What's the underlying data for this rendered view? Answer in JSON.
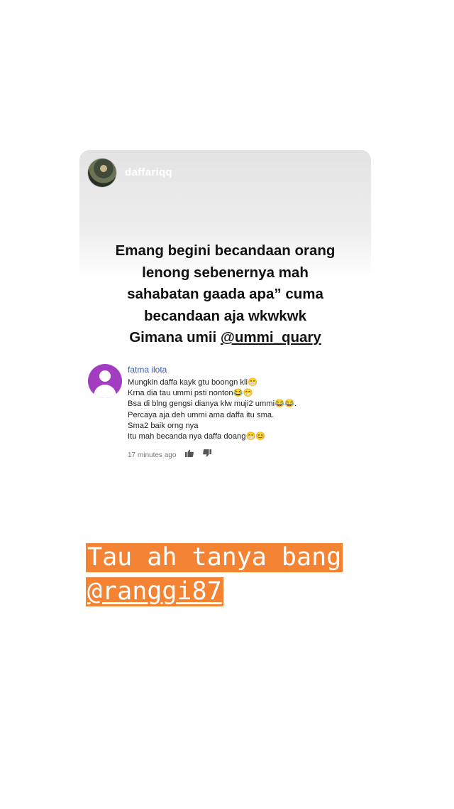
{
  "post": {
    "username": "daffariqq",
    "caption_lines": [
      "Emang begini becandaan orang",
      "lenong sebenernya mah",
      "sahabatan gaada apa” cuma",
      "becandaan aja wkwkwk"
    ],
    "caption_last_prefix": "Gimana umii ",
    "caption_mention": "@ummi_quary"
  },
  "comment": {
    "author": "fatma ilota",
    "text": "Mungkin daffa kayk gtu boongn kli😁\nKrna dia tau ummi psti nonton😂😁\nBsa di blng gengsi dianya klw muji2 ummi😂😂.\nPercaya aja deh ummi ama daffa itu sma.\nSma2 baik orng nya\nItu mah becanda nya daffa doang😁😊",
    "time": "17 minutes ago",
    "like_icon": "thumbs-up-icon",
    "dislike_icon": "thumbs-down-icon"
  },
  "sticker": {
    "line1": "Tau ah tanya bang",
    "mention": "@ranggi87",
    "bg_color": "#f48433"
  }
}
